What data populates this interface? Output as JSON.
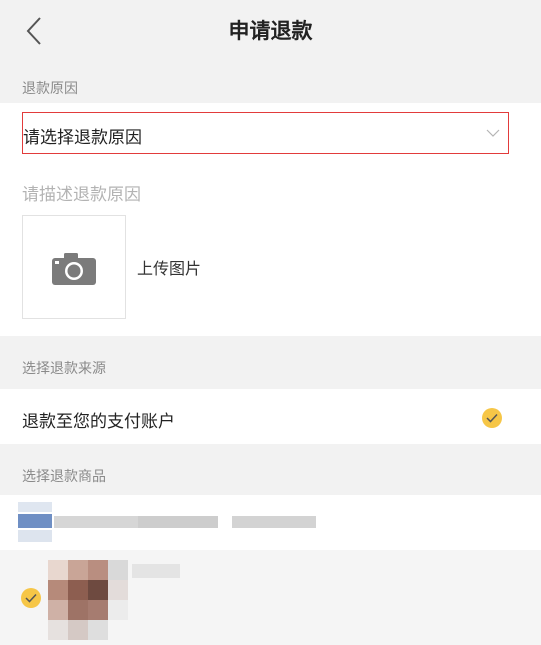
{
  "header": {
    "title": "申请退款",
    "back_icon": "chevron-left-icon"
  },
  "reason": {
    "section_label": "退款原因",
    "select_placeholder": "请选择退款原因",
    "description_placeholder": "请描述退款原因",
    "upload_label": "上传图片",
    "upload_icon": "camera-icon"
  },
  "source": {
    "section_label": "选择退款来源",
    "option_label": "退款至您的支付账户",
    "option_selected": true
  },
  "goods": {
    "section_label": "选择退款商品",
    "item_selected": true
  },
  "colors": {
    "accent": "#f6c647",
    "error_border": "#e23b3b",
    "background": "#f2f2f2"
  }
}
